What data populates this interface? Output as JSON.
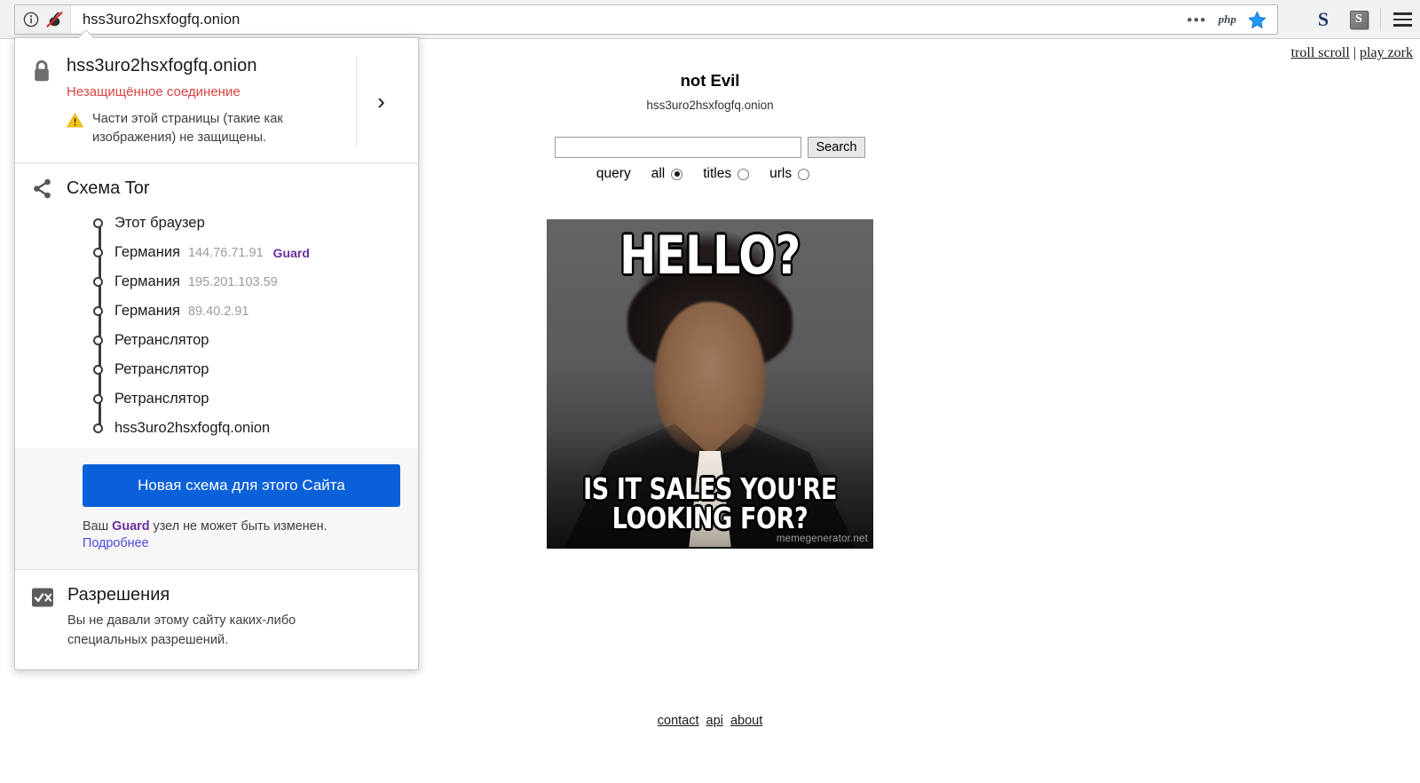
{
  "browser": {
    "url": "hss3uro2hsxfogfq.onion",
    "identity_icons": {
      "info": "info-icon",
      "onion": "onion-slashed-icon"
    },
    "toolbar": {
      "overflow": "•••",
      "php_badge": "php",
      "star": "bookmark-star-icon",
      "s_bold": "S",
      "s_box": "S",
      "menu": "hamburger-menu-icon"
    }
  },
  "identity_panel": {
    "site_host": "hss3uro2hsxfogfq.onion",
    "connection_status": "Незащищённое соединение",
    "mixed_content_warning": "Части этой страницы (такие как изображения) не защищены.",
    "expand_chevron": "›",
    "tor": {
      "title": "Схема Tor",
      "nodes": [
        {
          "name": "Этот браузер",
          "ip": "",
          "tag": ""
        },
        {
          "name": "Германия",
          "ip": "144.76.71.91",
          "tag": "Guard"
        },
        {
          "name": "Германия",
          "ip": "195.201.103.59",
          "tag": ""
        },
        {
          "name": "Германия",
          "ip": "89.40.2.91",
          "tag": ""
        },
        {
          "name": "Ретранслятор",
          "ip": "",
          "tag": ""
        },
        {
          "name": "Ретранслятор",
          "ip": "",
          "tag": ""
        },
        {
          "name": "Ретранслятор",
          "ip": "",
          "tag": ""
        },
        {
          "name": "hss3uro2hsxfogfq.onion",
          "ip": "",
          "tag": ""
        }
      ],
      "new_circuit_button": "Новая схема для этого Сайта",
      "guard_note_prefix": "Ваш ",
      "guard_note_bold": "Guard",
      "guard_note_suffix": " узел не может быть изменен.",
      "learn_more": "Подробнее"
    },
    "permissions": {
      "title": "Разрешения",
      "description": "Вы не давали этому сайту каких-либо специальных разрешений."
    }
  },
  "page": {
    "top_links": {
      "troll_scroll": "troll scroll",
      "separator": "|",
      "play_zork": "play zork"
    },
    "brand": "not Evil",
    "brand_host": "hss3uro2hsxfogfq.onion",
    "search": {
      "query_value": "",
      "query_placeholder": "",
      "button_label": "Search",
      "scope_label": "query",
      "options": [
        {
          "label": "all",
          "selected": true
        },
        {
          "label": "titles",
          "selected": false
        },
        {
          "label": "urls",
          "selected": false
        }
      ]
    },
    "meme": {
      "top_text": "HELLO?",
      "bottom_text": "IS IT SALES YOU'RE LOOKING FOR?",
      "watermark": "memegenerator.net"
    },
    "footer_links": [
      "contact",
      "api",
      "about"
    ]
  }
}
